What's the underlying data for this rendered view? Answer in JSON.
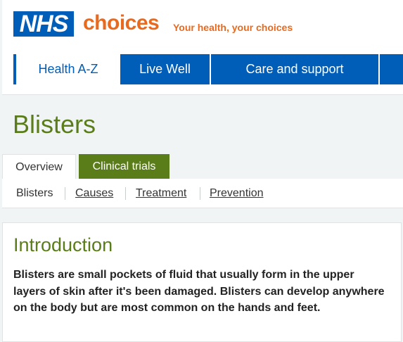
{
  "brand": {
    "logo": "NHS",
    "name": "choices",
    "tagline": "Your health, your choices",
    "logo_color": "#005eb8",
    "accent_color": "#e86a1f"
  },
  "nav": {
    "items": [
      {
        "label": "Health A-Z",
        "active": true
      },
      {
        "label": "Live Well",
        "active": false
      },
      {
        "label": "Care and support",
        "active": false
      },
      {
        "label": "",
        "active": false
      }
    ]
  },
  "page": {
    "title": "Blisters",
    "title_color": "#5a7d19"
  },
  "tabs": [
    {
      "label": "Overview",
      "active": true
    },
    {
      "label": "Clinical trials",
      "active": false
    }
  ],
  "subnav": [
    {
      "label": "Blisters",
      "current": true
    },
    {
      "label": "Causes",
      "current": false
    },
    {
      "label": "Treatment",
      "current": false
    },
    {
      "label": "Prevention",
      "current": false
    }
  ],
  "intro": {
    "heading": "Introduction",
    "body": "Blisters are small pockets of fluid that usually form in the upper layers of skin after it's been damaged. Blisters can develop anywhere on the body but are most common on the hands and feet."
  }
}
